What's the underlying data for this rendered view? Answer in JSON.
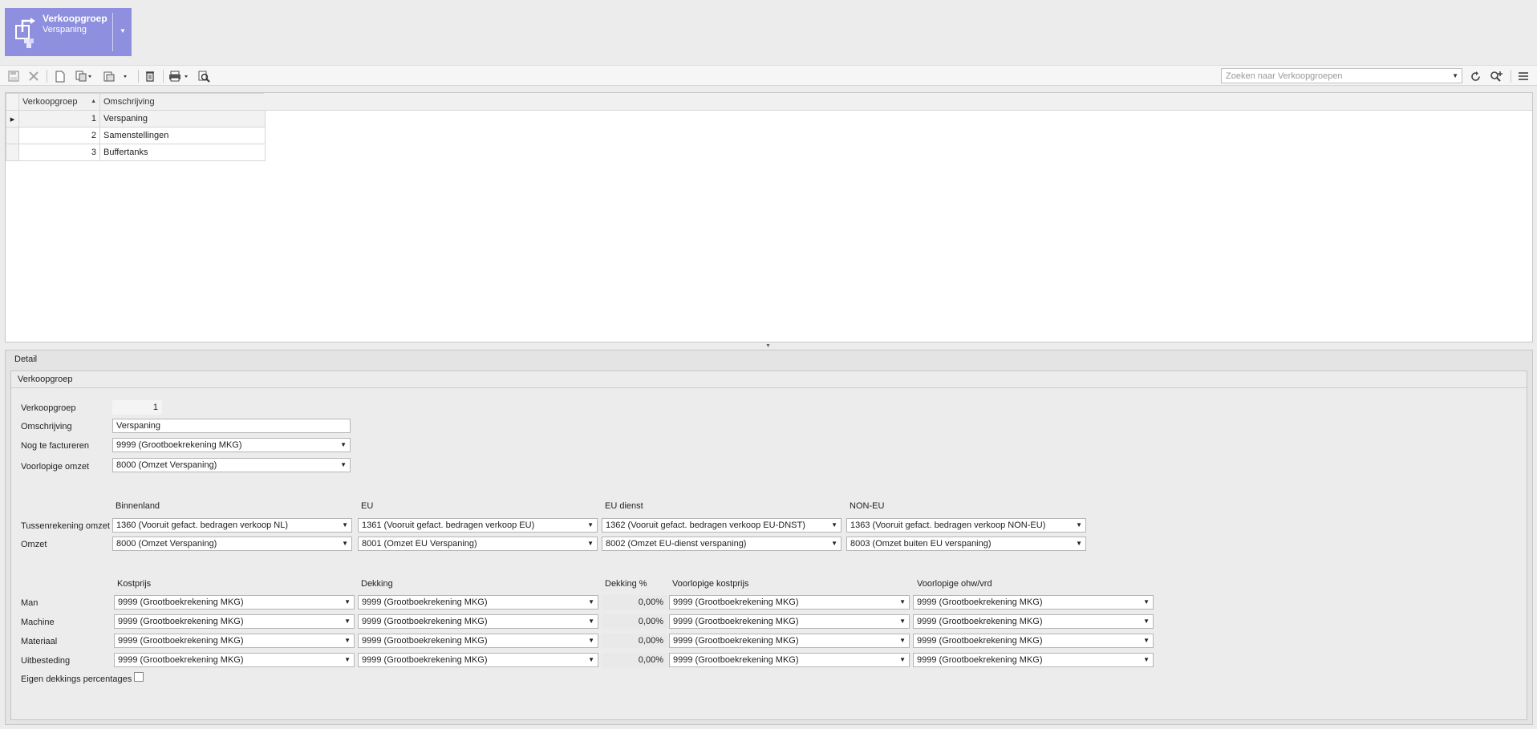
{
  "header": {
    "title": "Verkoopgroep",
    "subtitle": "Verspaning"
  },
  "toolbar": {
    "icons": [
      "save-icon",
      "discard-icon",
      "new-document-icon",
      "copy-icon",
      "paste-icon",
      "delete-icon",
      "print-icon",
      "preview-icon",
      "refresh-icon",
      "search-add-icon",
      "menu-icon"
    ],
    "search_placeholder": "Zoeken naar Verkoopgroepen"
  },
  "grid": {
    "columns": [
      "Verkoopgroep",
      "Omschrijving"
    ],
    "rows": [
      {
        "id": "1",
        "name": "Verspaning",
        "selected": true
      },
      {
        "id": "2",
        "name": "Samenstellingen",
        "selected": false
      },
      {
        "id": "3",
        "name": "Buffertanks",
        "selected": false
      }
    ]
  },
  "detail": {
    "panel_title": "Detail",
    "group_title": "Verkoopgroep",
    "verkoopgroep_label": "Verkoopgroep",
    "verkoopgroep_value": "1",
    "omschrijving_label": "Omschrijving",
    "omschrijving_value": "Verspaning",
    "nog_te_factureren_label": "Nog te factureren",
    "nog_te_factureren_value": "9999 (Grootboekrekening MKG)",
    "voorlopige_omzet_label": "Voorlopige omzet",
    "voorlopige_omzet_value": "8000 (Omzet Verspaning)",
    "region_columns": [
      "Binnenland",
      "EU",
      "EU dienst",
      "NON-EU"
    ],
    "tussenrekening_label": "Tussenrekening omzet",
    "tussenrekening_values": [
      "1360 (Vooruit gefact. bedragen verkoop NL)",
      "1361 (Vooruit gefact. bedragen verkoop EU)",
      "1362 (Vooruit gefact. bedragen verkoop EU-DNST)",
      "1363 (Vooruit gefact. bedragen verkoop NON-EU)"
    ],
    "omzet_label": "Omzet",
    "omzet_values": [
      "8000 (Omzet Verspaning)",
      "8001 (Omzet EU Verspaning)",
      "8002 (Omzet EU-dienst verspaning)",
      "8003 (Omzet buiten EU verspaning)"
    ],
    "cost_columns": [
      "Kostprijs",
      "Dekking",
      "Dekking %",
      "Voorlopige kostprijs",
      "Voorlopige ohw/vrd"
    ],
    "cost_rows": [
      {
        "label": "Man",
        "kostprijs": "9999 (Grootboekrekening MKG)",
        "dekking": "9999 (Grootboekrekening MKG)",
        "pct": "0,00%",
        "vkostprijs": "9999 (Grootboekrekening MKG)",
        "vohw": "9999 (Grootboekrekening MKG)"
      },
      {
        "label": "Machine",
        "kostprijs": "9999 (Grootboekrekening MKG)",
        "dekking": "9999 (Grootboekrekening MKG)",
        "pct": "0,00%",
        "vkostprijs": "9999 (Grootboekrekening MKG)",
        "vohw": "9999 (Grootboekrekening MKG)"
      },
      {
        "label": "Materiaal",
        "kostprijs": "9999 (Grootboekrekening MKG)",
        "dekking": "9999 (Grootboekrekening MKG)",
        "pct": "0,00%",
        "vkostprijs": "9999 (Grootboekrekening MKG)",
        "vohw": "9999 (Grootboekrekening MKG)"
      },
      {
        "label": "Uitbesteding",
        "kostprijs": "9999 (Grootboekrekening MKG)",
        "dekking": "9999 (Grootboekrekening MKG)",
        "pct": "0,00%",
        "vkostprijs": "9999 (Grootboekrekening MKG)",
        "vohw": "9999 (Grootboekrekening MKG)"
      }
    ],
    "eigen_dekkings_label": "Eigen dekkings percentages",
    "eigen_dekkings_checked": false
  },
  "colors": {
    "tile": "#8f8fdf",
    "background": "#ececec"
  }
}
